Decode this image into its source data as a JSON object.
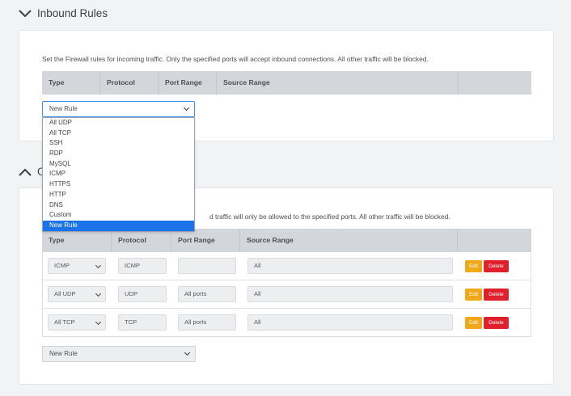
{
  "inbound": {
    "title": "Inbound Rules",
    "description": "Set the Firewall rules for incoming traffic. Only the specified ports will accept inbound connections. All other traffic will be blocked.",
    "columns": [
      "Type",
      "Protocol",
      "Port Range",
      "Source Range",
      ""
    ],
    "new_rule_select": "New Rule",
    "dropdown_options": [
      "All UDP",
      "All TCP",
      "SSH",
      "RDP",
      "MySQL",
      "ICMP",
      "HTTPS",
      "HTTP",
      "DNS",
      "Custom",
      "New Rule"
    ],
    "selected_option": "New Rule"
  },
  "outbound": {
    "title_visible": "O",
    "description_visible": "d traffic will only be allowed to the specified ports. All other traffic will be blocked.",
    "columns": [
      "Type",
      "Protocol",
      "Port Range",
      "Source Range",
      ""
    ],
    "rows": [
      {
        "type": "ICMP",
        "protocol": "ICMP",
        "port_range": "",
        "source_range": "All",
        "edit": "Edit",
        "delete": "Delete"
      },
      {
        "type": "All UDP",
        "protocol": "UDP",
        "port_range": "All ports",
        "source_range": "All",
        "edit": "Edit",
        "delete": "Delete"
      },
      {
        "type": "All TCP",
        "protocol": "TCP",
        "port_range": "All ports",
        "source_range": "All",
        "edit": "Edit",
        "delete": "Delete"
      }
    ],
    "new_rule_select": "New Rule"
  },
  "colors": {
    "edit_button": "#f0a818",
    "delete_button": "#e0202c",
    "selected_option": "#1a73e8",
    "table_header": "#d3d6db"
  }
}
